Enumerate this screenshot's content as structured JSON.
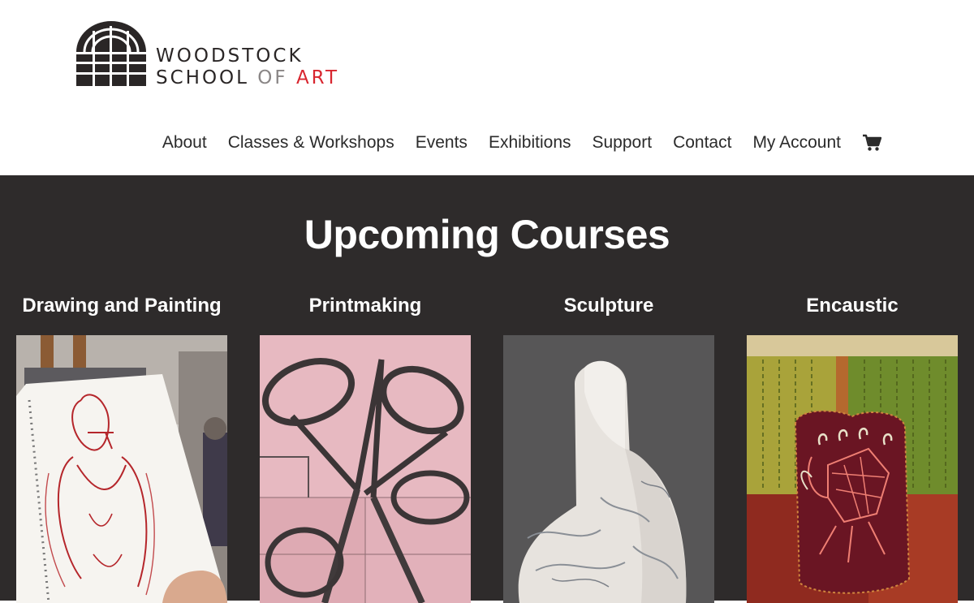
{
  "logo": {
    "line1": "WOODSTOCK",
    "line2_school": "SCHOOL ",
    "line2_of": "OF ",
    "line2_art": "ART"
  },
  "nav": {
    "items": [
      {
        "label": "About"
      },
      {
        "label": "Classes & Workshops"
      },
      {
        "label": "Events"
      },
      {
        "label": "Exhibitions"
      },
      {
        "label": "Support"
      },
      {
        "label": "Contact"
      },
      {
        "label": "My Account"
      }
    ],
    "cart_icon": "cart-icon"
  },
  "main": {
    "title": "Upcoming Courses",
    "courses": [
      {
        "title": "Drawing and Painting"
      },
      {
        "title": "Printmaking"
      },
      {
        "title": "Sculpture"
      },
      {
        "title": "Encaustic"
      }
    ]
  },
  "colors": {
    "band": "#2e2b2b",
    "accent": "#d8262f",
    "text": "#2b2b2b"
  }
}
